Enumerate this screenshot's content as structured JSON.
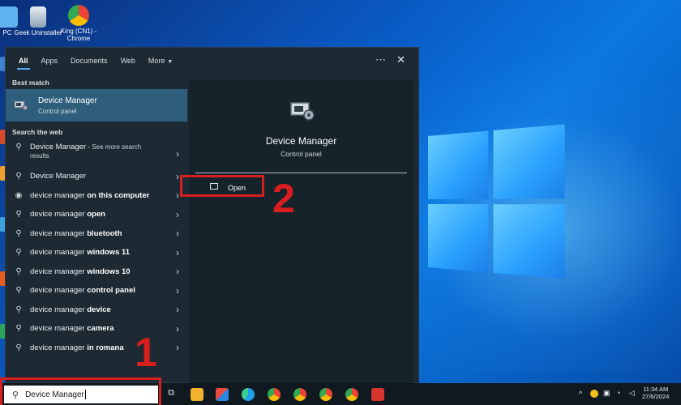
{
  "desktop": {
    "icons": [
      {
        "label": "PC"
      },
      {
        "label": "Geek Uninstaller"
      },
      {
        "label": "King (CN1) - Chrome"
      }
    ]
  },
  "start_menu": {
    "tabs": [
      "All",
      "Apps",
      "Documents",
      "Web",
      "More"
    ],
    "best_match": {
      "heading": "Best match",
      "title": "Device Manager",
      "subtitle": "Control panel"
    },
    "search_web_heading": "Search the web",
    "web_results": [
      {
        "query": "Device Manager",
        "suffix": "",
        "extra": " - See more search results"
      },
      {
        "query": "Device Manager",
        "suffix": "",
        "extra": ""
      },
      {
        "query": "device manager",
        "suffix": " on this computer",
        "extra": ""
      },
      {
        "query": "device manager",
        "suffix": " open",
        "extra": ""
      },
      {
        "query": "device manager",
        "suffix": " bluetooth",
        "extra": ""
      },
      {
        "query": "device manager",
        "suffix": " windows 11",
        "extra": ""
      },
      {
        "query": "device manager",
        "suffix": " windows 10",
        "extra": ""
      },
      {
        "query": "device manager",
        "suffix": " control panel",
        "extra": ""
      },
      {
        "query": "device manager",
        "suffix": " device",
        "extra": ""
      },
      {
        "query": "device manager",
        "suffix": " camera",
        "extra": ""
      },
      {
        "query": "device manager",
        "suffix": " in romana",
        "extra": ""
      }
    ],
    "detail": {
      "title": "Device Manager",
      "subtitle": "Control panel",
      "open_label": "Open"
    }
  },
  "annotations": {
    "step1": "1",
    "step2": "2",
    "color": "#d81e1e"
  },
  "taskbar": {
    "search_value": "Device Manager",
    "time": "11:34 AM",
    "date": "27/6/2024"
  }
}
